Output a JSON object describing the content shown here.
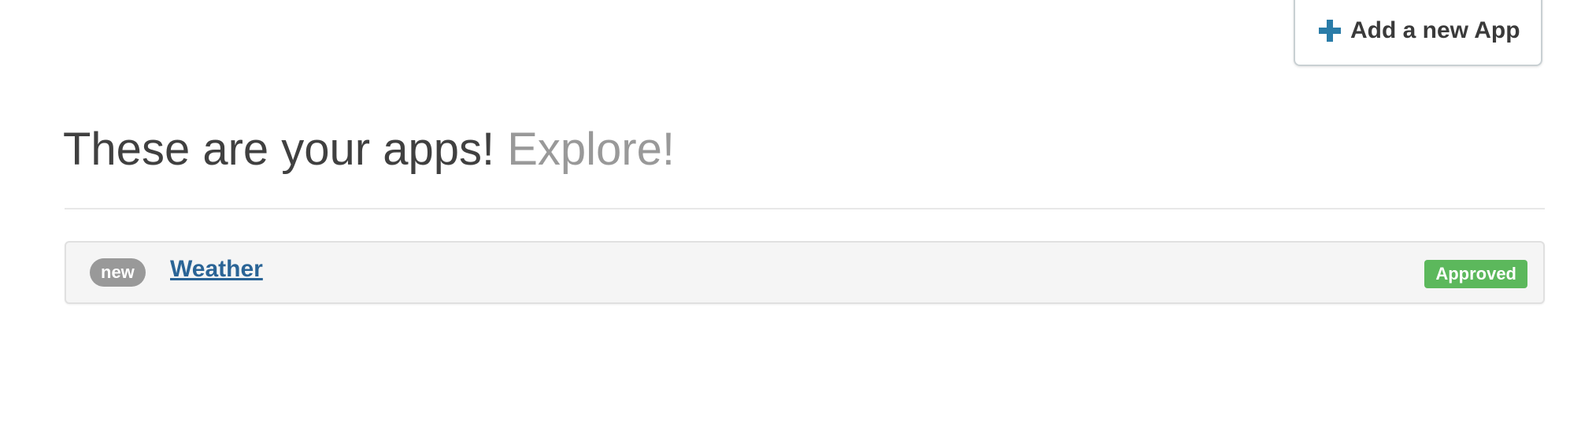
{
  "toolbar": {
    "add_app_label": "Add a new App",
    "add_app_icon": "plus-icon",
    "accent_color": "#2a7ca8"
  },
  "header": {
    "title": "These are your apps!",
    "subtitle": "Explore!"
  },
  "apps": [
    {
      "badge": "new",
      "name": "Weather",
      "status": "Approved",
      "status_color": "#5cb85c"
    }
  ]
}
